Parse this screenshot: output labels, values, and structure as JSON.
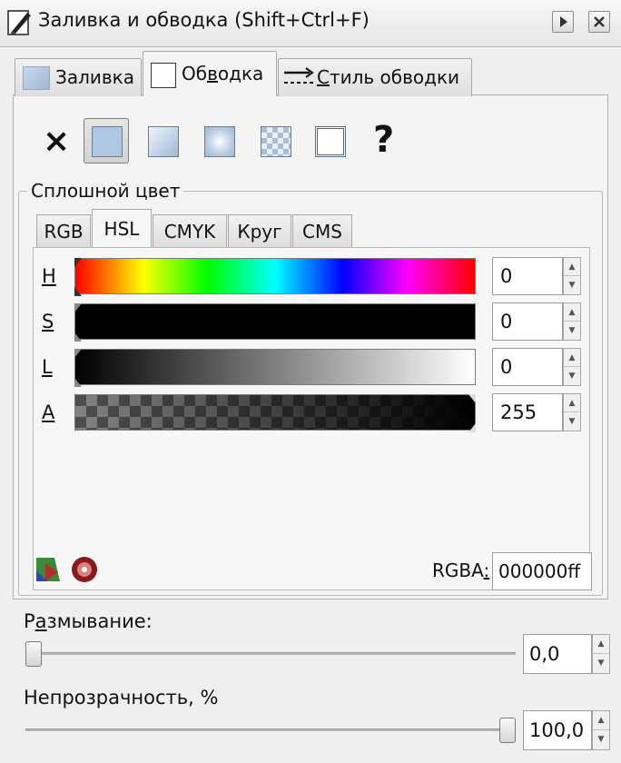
{
  "window": {
    "title": "Заливка и обводка (Shift+Ctrl+F)",
    "icon": "paintbrush-icon"
  },
  "tabs": [
    {
      "label_pre": "Заливка",
      "label_u": "",
      "label_post": "",
      "icon": "fill-tab-icon",
      "active": false
    },
    {
      "label_pre": "Об",
      "label_u": "в",
      "label_post": "одка",
      "icon": "stroke-paint-tab-icon",
      "active": true
    },
    {
      "label_pre": "",
      "label_u": "С",
      "label_post": "тиль обводки",
      "icon": "stroke-style-tab-icon",
      "active": false
    }
  ],
  "paint_modes": {
    "none_glyph": "×",
    "unset_glyph": "?",
    "selected": "flat-color",
    "flat_color": "#aec8e3"
  },
  "solid_color": {
    "group_title": "Сплошной цвет",
    "tabs": [
      "RGB",
      "HSL",
      "CMYK",
      "Круг",
      "CMS"
    ],
    "active_tab": "HSL",
    "channels": [
      {
        "label": "H",
        "value": "0"
      },
      {
        "label": "S",
        "value": "0"
      },
      {
        "label": "L",
        "value": "0"
      },
      {
        "label": "A",
        "value": "255"
      }
    ],
    "rgba_label_pre": "RGBA",
    "rgba_label_u": ":",
    "rgba_value": "000000ff"
  },
  "blur": {
    "label_pre": "Р",
    "label_u": "а",
    "label_post": "змывание:",
    "value": "0,0",
    "fraction": 0
  },
  "opacity": {
    "label": "Непрозрачность, %",
    "value": "100,0",
    "fraction": 1
  }
}
